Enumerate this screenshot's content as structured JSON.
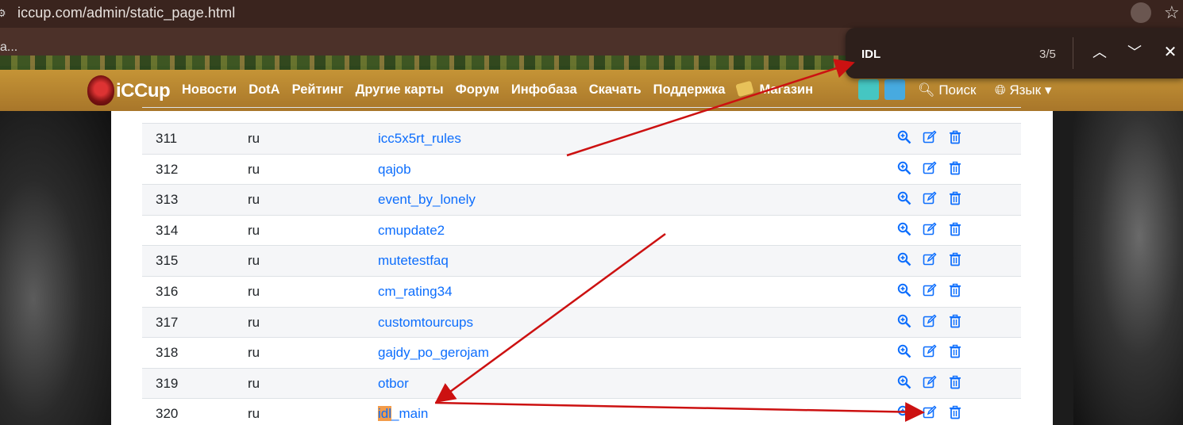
{
  "browser": {
    "url": "iccup.com/admin/static_page.html",
    "tab_fragment": "a..."
  },
  "find_bar": {
    "query": "IDL",
    "count": "3/5"
  },
  "site": {
    "logo_text": "iCCup",
    "nav": [
      "Новости",
      "DotA",
      "Рейтинг",
      "Другие карты",
      "Форум",
      "Инфобаза",
      "Скачать",
      "Поддержка",
      "Магазин"
    ],
    "search_label": "Поиск",
    "language_label": "Язык"
  },
  "table": {
    "rows": [
      {
        "id": "311",
        "lang": "ru",
        "name": "icc5x5rt_rules"
      },
      {
        "id": "312",
        "lang": "ru",
        "name": "qajob"
      },
      {
        "id": "313",
        "lang": "ru",
        "name": "event_by_lonely"
      },
      {
        "id": "314",
        "lang": "ru",
        "name": "cmupdate2"
      },
      {
        "id": "315",
        "lang": "ru",
        "name": "mutetestfaq"
      },
      {
        "id": "316",
        "lang": "ru",
        "name": "cm_rating34"
      },
      {
        "id": "317",
        "lang": "ru",
        "name": "customtourcups"
      },
      {
        "id": "318",
        "lang": "ru",
        "name": "gajdy_po_gerojam"
      },
      {
        "id": "319",
        "lang": "ru",
        "name": "otbor"
      },
      {
        "id": "320",
        "lang": "ru",
        "name_highlight": "idl",
        "name_rest": "_main"
      }
    ]
  },
  "colors": {
    "link": "#0d6efd",
    "annotation_arrow": "#cc1111",
    "find_highlight": "#f39c4a"
  }
}
